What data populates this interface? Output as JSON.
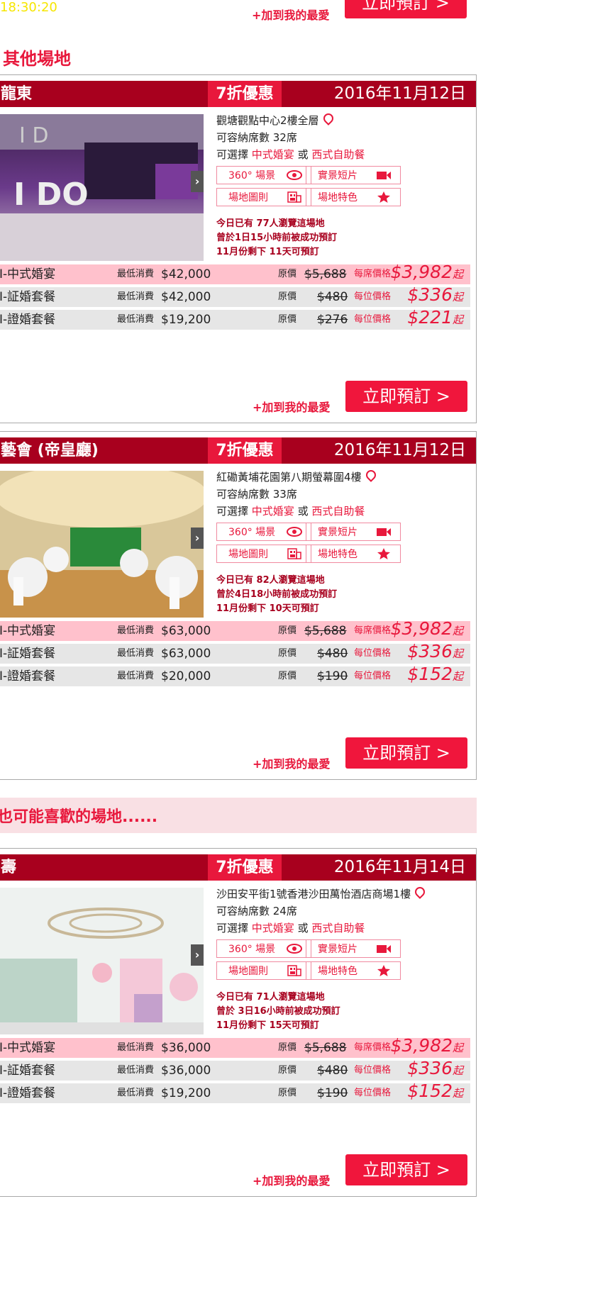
{
  "time": "18:30:20",
  "fav_label": "+加到我的最愛",
  "book_label": "立即預訂 >",
  "section_other": "其他場地",
  "section_like": "也可能喜歡的場地......",
  "min_label": "最低消費",
  "orig_label": "原價",
  "per_label_first": "每席價格",
  "per_label_other": "每位價格",
  "per_suffix": "起",
  "buttons": {
    "view360": "360° 場景",
    "video": "實景短片",
    "floorplan": "場地圖則",
    "features": "場地特色"
  },
  "or_word": "或",
  "choose_word": "可選擇",
  "chinese_option": "中式婚宴",
  "western_option": "西式自助餐",
  "cards": [
    {
      "name": "龍東",
      "discount": "7折優惠",
      "date": "2016年11月12日",
      "address": "觀塘觀點中心2樓全層",
      "capacity": "可容納席數 32席",
      "stats": [
        "今日已有 77人瀏覽這場地",
        "曾於1日15小時前被成功預訂",
        "11月份剩下 11天可預訂"
      ],
      "packages": [
        {
          "name": "I-中式婚宴",
          "min": "$42,000",
          "orig": "$5,688",
          "price": "$3,982"
        },
        {
          "name": "I-証婚套餐",
          "min": "$42,000",
          "orig": "$480",
          "price": "$336"
        },
        {
          "name": "I-證婚套餐",
          "min": "$19,200",
          "orig": "$276",
          "price": "$221"
        }
      ]
    },
    {
      "name": "藝會 (帝皇廳)",
      "discount": "7折優惠",
      "date": "2016年11月12日",
      "address": "紅磡黃埔花園第八期螢幕圍4樓",
      "capacity": "可容納席數 33席",
      "stats": [
        "今日已有 82人瀏覽這場地",
        "曾於4日18小時前被成功預訂",
        "11月份剩下 10天可預訂"
      ],
      "packages": [
        {
          "name": "I-中式婚宴",
          "min": "$63,000",
          "orig": "$5,688",
          "price": "$3,982"
        },
        {
          "name": "I-証婚套餐",
          "min": "$63,000",
          "orig": "$480",
          "price": "$336"
        },
        {
          "name": "I-證婚套餐",
          "min": "$20,000",
          "orig": "$190",
          "price": "$152"
        }
      ]
    },
    {
      "name": "壽",
      "discount": "7折優惠",
      "date": "2016年11月14日",
      "address": "沙田安平街1號香港沙田萬怡酒店商場1樓",
      "capacity": "可容納席數 24席",
      "stats": [
        "今日已有 71人瀏覽這場地",
        "曾於 3日16小時前被成功預訂",
        "11月份剩下 15天可預訂"
      ],
      "packages": [
        {
          "name": "I-中式婚宴",
          "min": "$36,000",
          "orig": "$5,688",
          "price": "$3,982"
        },
        {
          "name": "I-証婚套餐",
          "min": "$36,000",
          "orig": "$480",
          "price": "$336"
        },
        {
          "name": "I-證婚套餐",
          "min": "$19,200",
          "orig": "$190",
          "price": "$152"
        }
      ]
    }
  ]
}
